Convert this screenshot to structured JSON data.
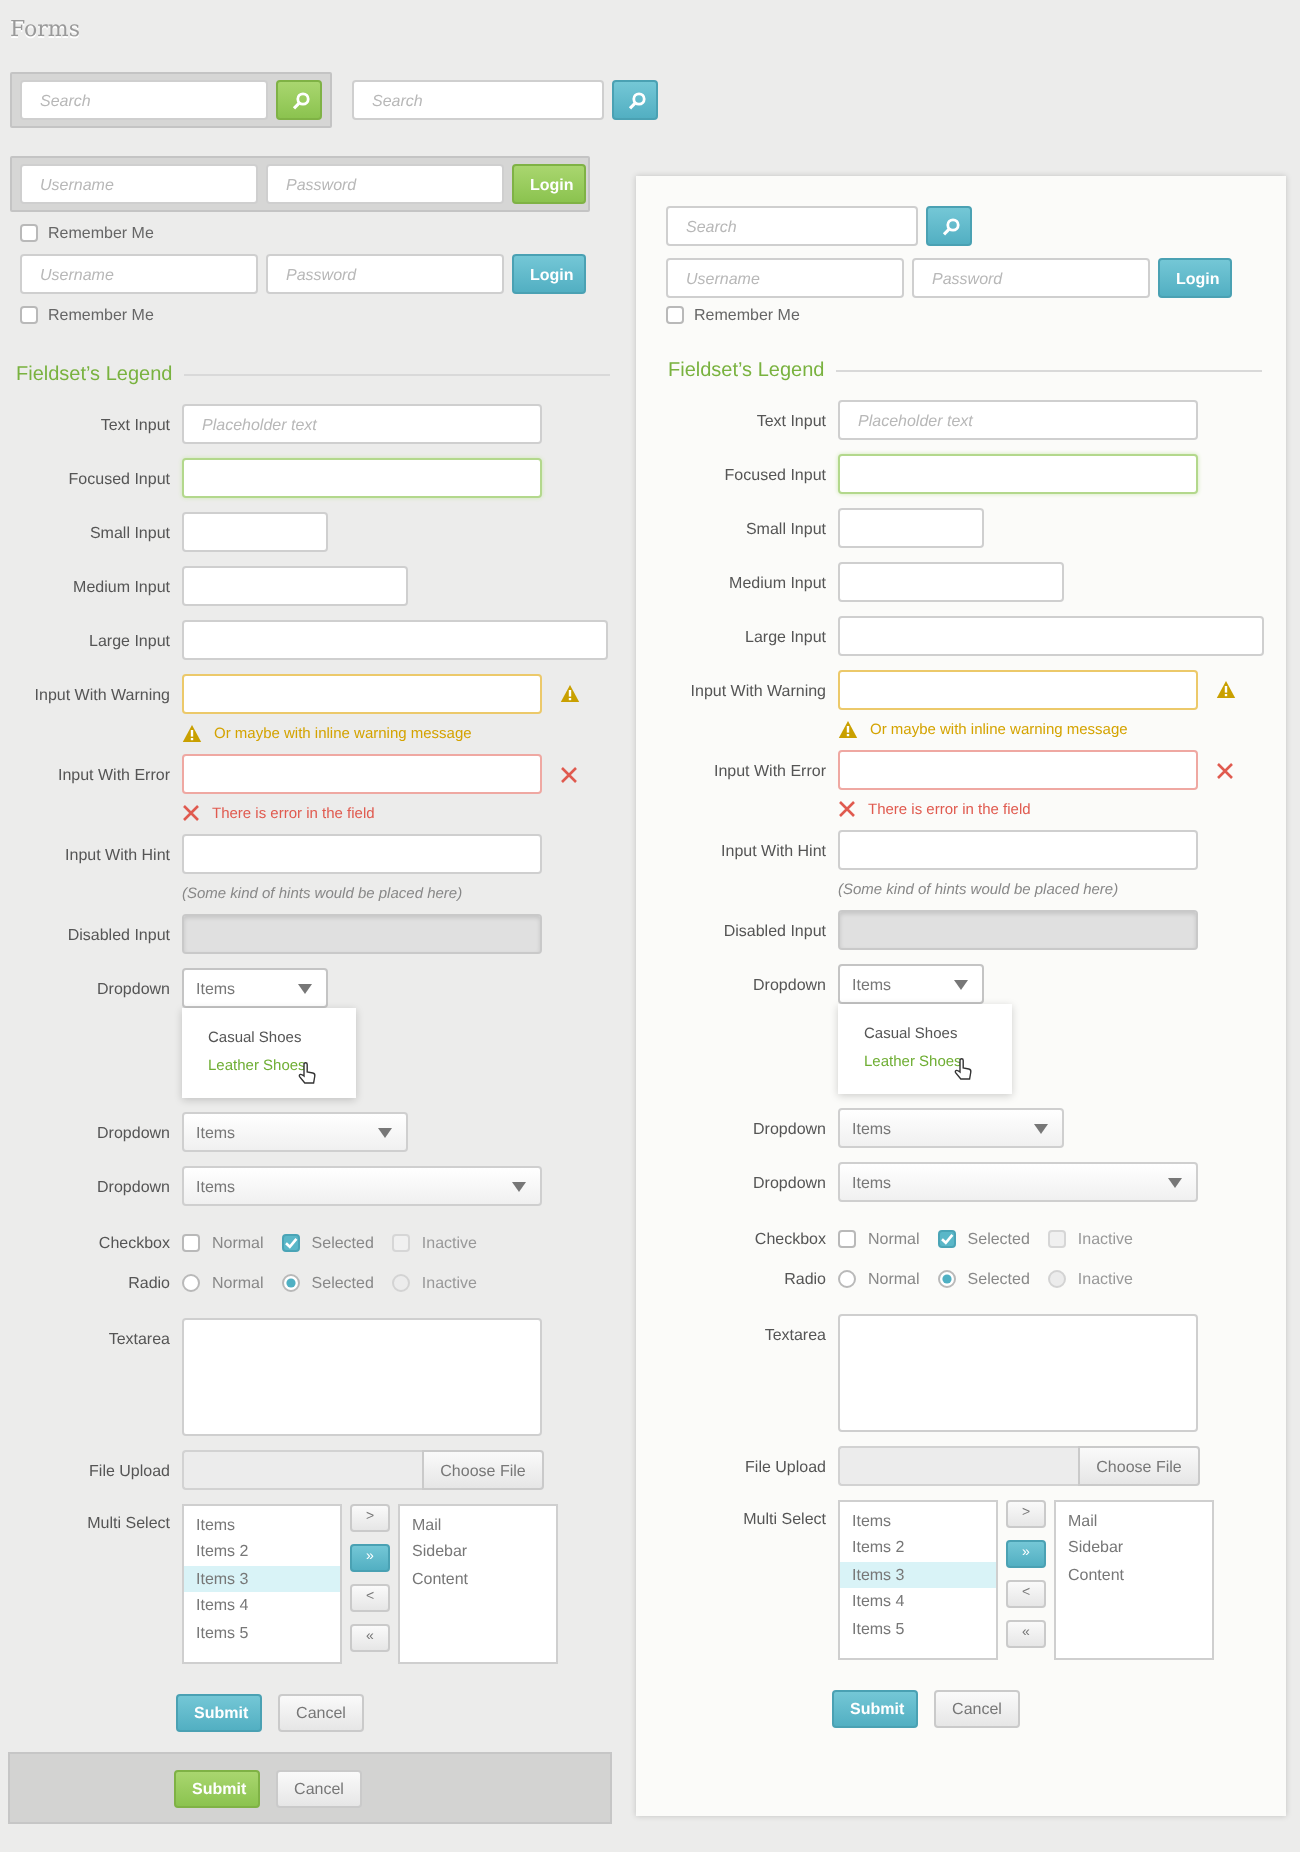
{
  "title": "Forms",
  "panels": [
    {
      "kind": "plain",
      "searches": [
        {
          "placeholder": "Search",
          "kind": "success",
          "framed": true
        },
        {
          "placeholder": "Search",
          "kind": "info",
          "framed": false
        }
      ],
      "logins": [
        {
          "username": {
            "placeholder": "Username"
          },
          "password": {
            "placeholder": "Password"
          },
          "button": "Login",
          "kind": "success",
          "framed": true,
          "remember": {
            "label": "Remember Me",
            "checked": false
          }
        },
        {
          "username": {
            "placeholder": "Username"
          },
          "password": {
            "placeholder": "Password"
          },
          "button": "Login",
          "kind": "info",
          "framed": false,
          "remember": {
            "label": "Remember Me",
            "checked": false
          }
        }
      ],
      "legend": "Fieldset’s Legend",
      "fields": [
        {
          "kind": "text",
          "label": "Text Input",
          "placeholder": "Placeholder text",
          "focused": false,
          "disabled": false
        },
        {
          "kind": "text",
          "label": "Focused Input",
          "focused": true,
          "disabled": false
        },
        {
          "kind": "text",
          "label": "Small Input",
          "focused": false,
          "disabled": false
        },
        {
          "kind": "text",
          "label": "Medium Input",
          "focused": false,
          "disabled": false
        },
        {
          "kind": "text",
          "label": "Large Input",
          "focused": false,
          "disabled": false
        },
        {
          "kind": "text",
          "label": "Input With Warning",
          "focused": false,
          "disabled": false,
          "warning": "Or maybe with inline warning message"
        },
        {
          "kind": "text",
          "label": "Input With Error",
          "focused": false,
          "disabled": false,
          "error": "There is error in the field"
        },
        {
          "kind": "text",
          "label": "Input With Hint",
          "focused": false,
          "disabled": false,
          "hint": "(Some kind of hints would be placed here)"
        },
        {
          "kind": "text",
          "label": "Disabled Input",
          "focused": false,
          "disabled": true
        },
        {
          "kind": "dropdown",
          "label": "Dropdown",
          "value": "Items",
          "expanded": true,
          "options": [
            {
              "label": "Casual Shoes",
              "hovered": false
            },
            {
              "label": "Leather Shoes",
              "hovered": true
            }
          ]
        },
        {
          "kind": "dropdown",
          "label": "Dropdown",
          "value": "Items"
        },
        {
          "kind": "dropdown",
          "label": "Dropdown",
          "value": "Items"
        },
        {
          "kind": "checkbox",
          "label": "Checkbox",
          "options": [
            {
              "label": "Normal",
              "checked": false,
              "disabled": false
            },
            {
              "label": "Selected",
              "checked": true,
              "disabled": false
            },
            {
              "label": "Inactive",
              "checked": false,
              "disabled": true
            }
          ]
        },
        {
          "kind": "radio",
          "label": "Radio",
          "options": [
            {
              "label": "Normal",
              "selected": false,
              "disabled": false
            },
            {
              "label": "Selected",
              "selected": true,
              "disabled": false
            },
            {
              "label": "Inactive",
              "selected": false,
              "disabled": true
            }
          ]
        },
        {
          "kind": "textarea",
          "label": "Textarea"
        },
        {
          "kind": "file",
          "label": "File Upload",
          "button": "Choose File"
        },
        {
          "kind": "multiselect",
          "label": "Multi Select",
          "source": [
            {
              "label": "Items",
              "selected": false
            },
            {
              "label": "Items 2",
              "selected": false
            },
            {
              "label": "Items 3",
              "selected": true
            },
            {
              "label": "Items 4",
              "selected": false
            },
            {
              "label": "Items 5",
              "selected": false
            }
          ],
          "moves": [
            {
              "label": ">",
              "active": false
            },
            {
              "label": "»",
              "active": true
            },
            {
              "label": "<",
              "active": false
            },
            {
              "label": "«",
              "active": false
            }
          ],
          "target": [
            {
              "label": "Mail",
              "selected": false
            },
            {
              "label": "Sidebar",
              "selected": false
            },
            {
              "label": "Content",
              "selected": false
            }
          ]
        }
      ],
      "actions": [
        {
          "framed": false,
          "buttons": [
            {
              "label": "Submit",
              "kind": "info"
            },
            {
              "label": "Cancel",
              "kind": "default"
            }
          ]
        },
        {
          "framed": true,
          "buttons": [
            {
              "label": "Submit",
              "kind": "success"
            },
            {
              "label": "Cancel",
              "kind": "default"
            }
          ]
        }
      ]
    },
    {
      "kind": "card",
      "searches": [
        {
          "placeholder": "Search",
          "kind": "info",
          "framed": false
        }
      ],
      "logins": [
        {
          "username": {
            "placeholder": "Username"
          },
          "password": {
            "placeholder": "Password"
          },
          "button": "Login",
          "kind": "info",
          "framed": false,
          "remember": {
            "label": "Remember Me",
            "checked": false
          }
        }
      ],
      "legend": "Fieldset’s Legend",
      "fields": [
        {
          "kind": "text",
          "label": "Text Input",
          "placeholder": "Placeholder text",
          "focused": false,
          "disabled": false
        },
        {
          "kind": "text",
          "label": "Focused Input",
          "focused": true,
          "disabled": false
        },
        {
          "kind": "text",
          "label": "Small Input",
          "focused": false,
          "disabled": false
        },
        {
          "kind": "text",
          "label": "Medium Input",
          "focused": false,
          "disabled": false
        },
        {
          "kind": "text",
          "label": "Large Input",
          "focused": false,
          "disabled": false
        },
        {
          "kind": "text",
          "label": "Input With Warning",
          "focused": false,
          "disabled": false,
          "warning": "Or maybe with inline warning message"
        },
        {
          "kind": "text",
          "label": "Input With Error",
          "focused": false,
          "disabled": false,
          "error": "There is error in the field"
        },
        {
          "kind": "text",
          "label": "Input With Hint",
          "focused": false,
          "disabled": false,
          "hint": "(Some kind of hints would be placed here)"
        },
        {
          "kind": "text",
          "label": "Disabled Input",
          "focused": false,
          "disabled": true
        },
        {
          "kind": "dropdown",
          "label": "Dropdown",
          "value": "Items",
          "expanded": true,
          "options": [
            {
              "label": "Casual Shoes",
              "hovered": false
            },
            {
              "label": "Leather Shoes",
              "hovered": true
            }
          ]
        },
        {
          "kind": "dropdown",
          "label": "Dropdown",
          "value": "Items"
        },
        {
          "kind": "dropdown",
          "label": "Dropdown",
          "value": "Items"
        },
        {
          "kind": "checkbox",
          "label": "Checkbox",
          "options": [
            {
              "label": "Normal",
              "checked": false,
              "disabled": false
            },
            {
              "label": "Selected",
              "checked": true,
              "disabled": false
            },
            {
              "label": "Inactive",
              "checked": false,
              "disabled": true
            }
          ]
        },
        {
          "kind": "radio",
          "label": "Radio",
          "options": [
            {
              "label": "Normal",
              "selected": false,
              "disabled": false
            },
            {
              "label": "Selected",
              "selected": true,
              "disabled": false
            },
            {
              "label": "Inactive",
              "selected": false,
              "disabled": true
            }
          ]
        },
        {
          "kind": "textarea",
          "label": "Textarea"
        },
        {
          "kind": "file",
          "label": "File Upload",
          "button": "Choose File"
        },
        {
          "kind": "multiselect",
          "label": "Multi Select",
          "source": [
            {
              "label": "Items",
              "selected": false
            },
            {
              "label": "Items 2",
              "selected": false
            },
            {
              "label": "Items 3",
              "selected": true
            },
            {
              "label": "Items 4",
              "selected": false
            },
            {
              "label": "Items 5",
              "selected": false
            }
          ],
          "moves": [
            {
              "label": ">",
              "active": false
            },
            {
              "label": "»",
              "active": true
            },
            {
              "label": "<",
              "active": false
            },
            {
              "label": "«",
              "active": false
            }
          ],
          "target": [
            {
              "label": "Mail",
              "selected": false
            },
            {
              "label": "Sidebar",
              "selected": false
            },
            {
              "label": "Content",
              "selected": false
            }
          ]
        }
      ],
      "actions": [
        {
          "framed": false,
          "buttons": [
            {
              "label": "Submit",
              "kind": "info"
            },
            {
              "label": "Cancel",
              "kind": "default"
            }
          ]
        }
      ]
    }
  ]
}
